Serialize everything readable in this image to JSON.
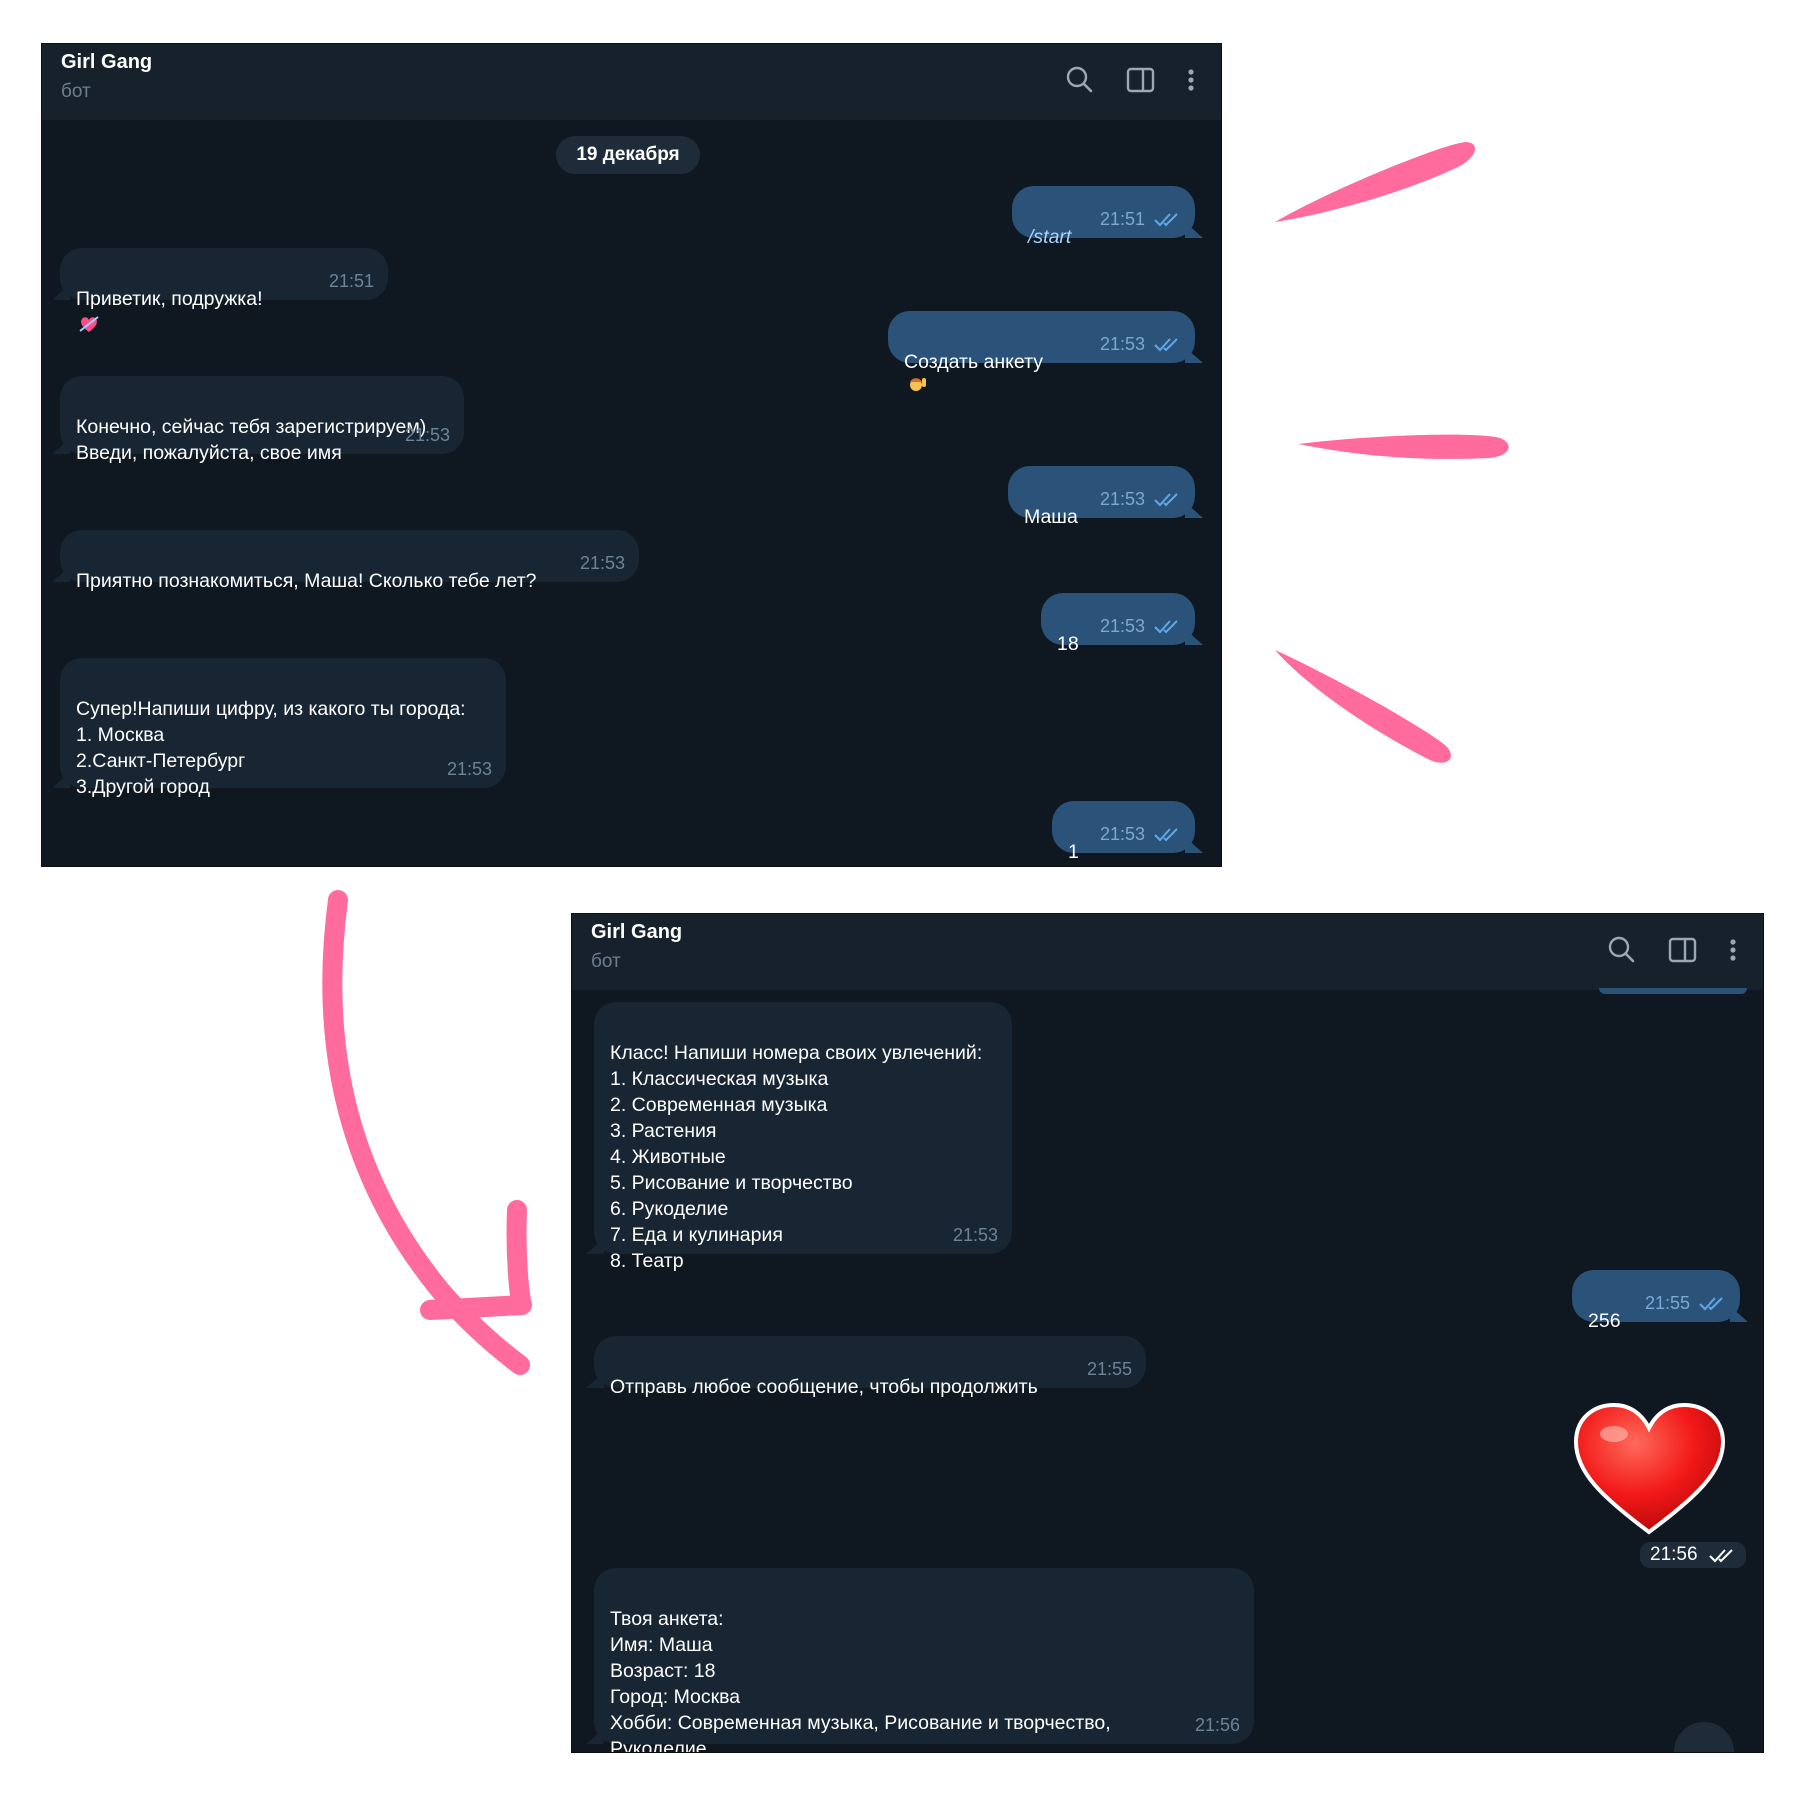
{
  "header": {
    "title": "Girl Gang",
    "subtitle": "бот"
  },
  "icons": {
    "search": "search-icon",
    "sidebar": "sidebar-toggle-icon",
    "menu": "more-vert-icon"
  },
  "colors": {
    "chat_bg": "#0f1720",
    "header_bg": "#17212b",
    "incoming": "#182533",
    "outgoing": "#2b5278",
    "check": "#5fa8e8",
    "accent_pink": "#ff6b9d"
  },
  "chat1": {
    "date": "19 декабря",
    "messages": [
      {
        "dir": "out",
        "text": "/start",
        "time": "21:51"
      },
      {
        "dir": "in",
        "text": "Приветик, подружка!",
        "time": "21:51"
      },
      {
        "dir": "out",
        "text": "Создать анкету",
        "time": "21:53"
      },
      {
        "dir": "in",
        "text": "Конечно, сейчас тебя зарегистрируем)\n Введи, пожалуйста, свое имя",
        "time": "21:53"
      },
      {
        "dir": "out",
        "text": "Маша",
        "time": "21:53"
      },
      {
        "dir": "in",
        "text": "Приятно познакомиться, Маша! Сколько тебе лет?",
        "time": "21:53"
      },
      {
        "dir": "out",
        "text": "18",
        "time": "21:53"
      },
      {
        "dir": "in",
        "text": "Супер!Напиши цифру, из какого ты города:\n1. Москва\n2.Санкт-Петербург\n3.Другой город",
        "time": "21:53"
      },
      {
        "dir": "out",
        "text": "1",
        "time": "21:53"
      }
    ]
  },
  "chat2": {
    "messages": [
      {
        "dir": "in",
        "text": "Класс! Напиши номера своих увлечений:\n1. Классическая музыка\n2. Современная музыка\n3. Растения\n4. Животные\n5. Рисование и творчество\n6. Рукоделие\n7. Еда и кулинария\n8. Театр",
        "time": "21:53"
      },
      {
        "dir": "out",
        "text": "256",
        "time": "21:55"
      },
      {
        "dir": "in",
        "text": "Отправь любое сообщение, чтобы продолжить",
        "time": "21:55"
      },
      {
        "dir": "out",
        "text": "",
        "time": "21:56",
        "sticker": "heart-sticker"
      },
      {
        "dir": "in",
        "text": "Твоя анкета:\nИмя: Маша\nВозраст: 18\nГород: Москва\nХобби: Современная музыка, Рисование и творчество,\nРукоделие",
        "time": "21:56"
      }
    ]
  }
}
